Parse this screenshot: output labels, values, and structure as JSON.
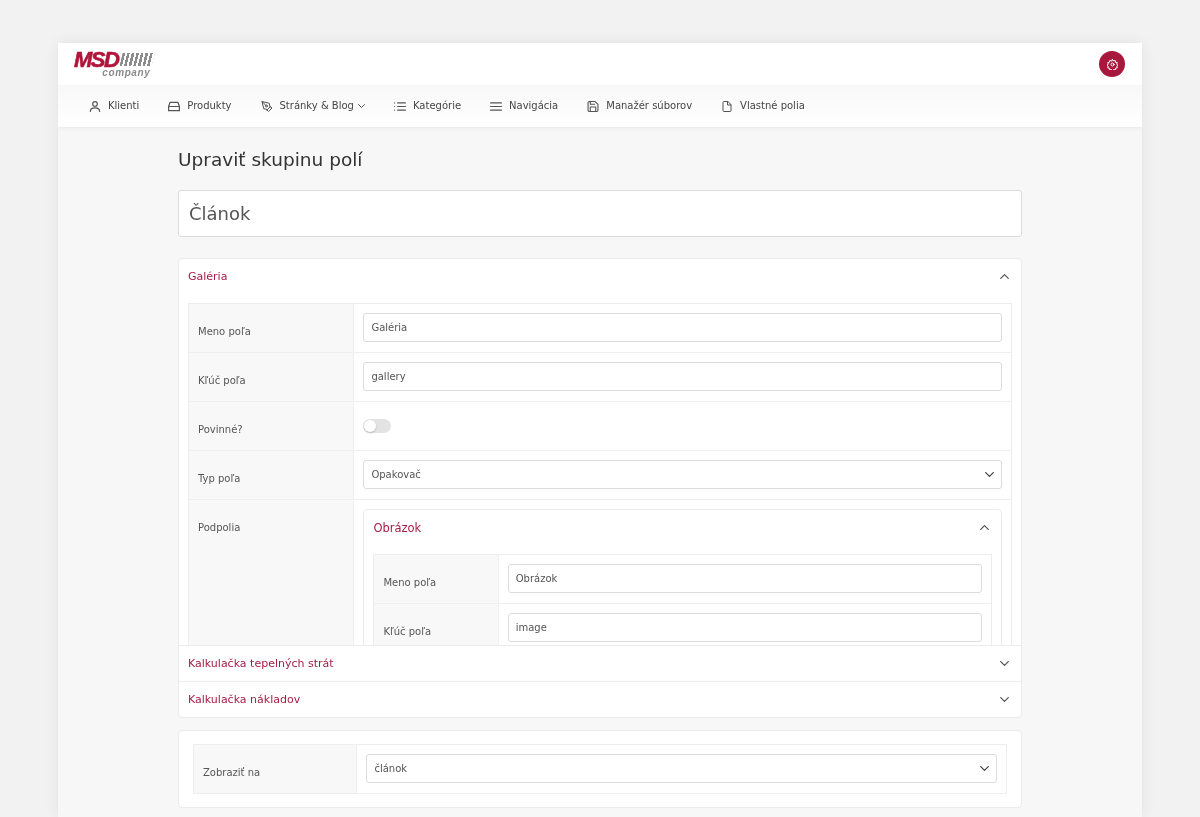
{
  "header": {
    "logo": {
      "primary": "MSD",
      "secondary": "company"
    }
  },
  "nav": [
    {
      "label": "Klienti",
      "dropdown": false
    },
    {
      "label": "Produkty",
      "dropdown": false
    },
    {
      "label": "Stránky & Blog",
      "dropdown": true
    },
    {
      "label": "Kategórie",
      "dropdown": false
    },
    {
      "label": "Navigácia",
      "dropdown": false
    },
    {
      "label": "Manažér súborov",
      "dropdown": false
    },
    {
      "label": "Vlastné polia",
      "dropdown": false
    }
  ],
  "page_title": "Upraviť skupinu polí",
  "group_name": {
    "value": "Článok"
  },
  "field_groups": [
    {
      "title": "Galéria",
      "expanded": true,
      "rows": [
        {
          "kind": "text",
          "label": "Meno poľa",
          "value": "Galéria"
        },
        {
          "kind": "text",
          "label": "Kľúč poľa",
          "value": "gallery"
        },
        {
          "kind": "toggle",
          "label": "Povinné?",
          "on": false
        },
        {
          "kind": "select",
          "label": "Typ poľa",
          "value": "Opakovač"
        },
        {
          "kind": "subfields",
          "label": "Podpolia",
          "groups": [
            {
              "title": "Obrázok",
              "expanded": true,
              "rows": [
                {
                  "kind": "text",
                  "label": "Meno poľa",
                  "value": "Obrázok"
                },
                {
                  "kind": "text",
                  "label": "Kľúč poľa",
                  "value": "image"
                }
              ]
            }
          ]
        }
      ]
    },
    {
      "title": "Kalkulačka tepelných strát",
      "expanded": false
    },
    {
      "title": "Kalkulačka nákladov",
      "expanded": false
    }
  ],
  "location": {
    "rows": [
      {
        "kind": "select",
        "label": "Zobraziť na",
        "value": "článok"
      }
    ]
  }
}
